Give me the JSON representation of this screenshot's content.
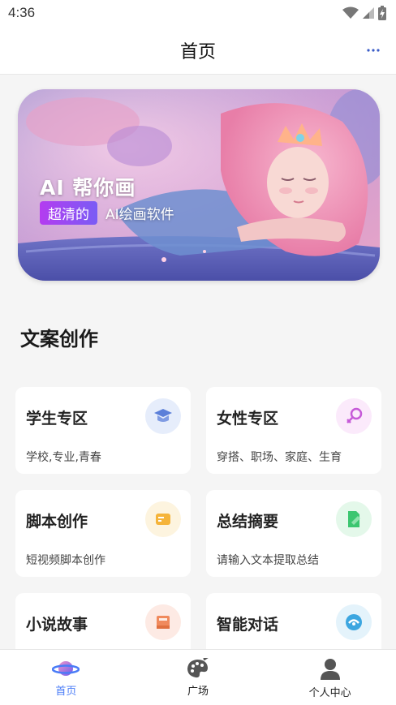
{
  "status_bar": {
    "time": "4:36"
  },
  "header": {
    "title": "首页",
    "more_icon": "more-dots-icon"
  },
  "banner": {
    "title": "AI 帮你画",
    "tag": "超清的",
    "subtitle": "AI绘画软件"
  },
  "section": {
    "title": "文案创作"
  },
  "cards": [
    {
      "title": "学生专区",
      "desc": "学校,专业,青春",
      "icon": "graduation-cap-icon",
      "icon_bg": "#e6edfb",
      "icon_color": "#5b7fd9"
    },
    {
      "title": "女性专区",
      "desc": "穿搭、职场、家庭、生育",
      "icon": "female-symbol-icon",
      "icon_bg": "#fbeafb",
      "icon_color": "#c65ad8"
    },
    {
      "title": "脚本创作",
      "desc": "短视频脚本创作",
      "icon": "script-box-icon",
      "icon_bg": "#fdf4df",
      "icon_color": "#f5b43a"
    },
    {
      "title": "总结摘要",
      "desc": "请输入文本提取总结",
      "icon": "document-summary-icon",
      "icon_bg": "#e4f8ea",
      "icon_color": "#3cc670"
    },
    {
      "title": "小说故事",
      "desc": "",
      "icon": "book-icon",
      "icon_bg": "#fdeae4",
      "icon_color": "#f08a5d"
    },
    {
      "title": "智能对话",
      "desc": "",
      "icon": "chat-bubble-icon",
      "icon_bg": "#e4f3fb",
      "icon_color": "#3ca6e0"
    }
  ],
  "bottom_nav": [
    {
      "label": "首页",
      "icon": "planet-icon",
      "active": true
    },
    {
      "label": "广场",
      "icon": "palette-icon",
      "active": false
    },
    {
      "label": "个人中心",
      "icon": "user-icon",
      "active": false
    }
  ],
  "colors": {
    "accent": "#4a7cf7",
    "background": "#f5f5f5"
  }
}
